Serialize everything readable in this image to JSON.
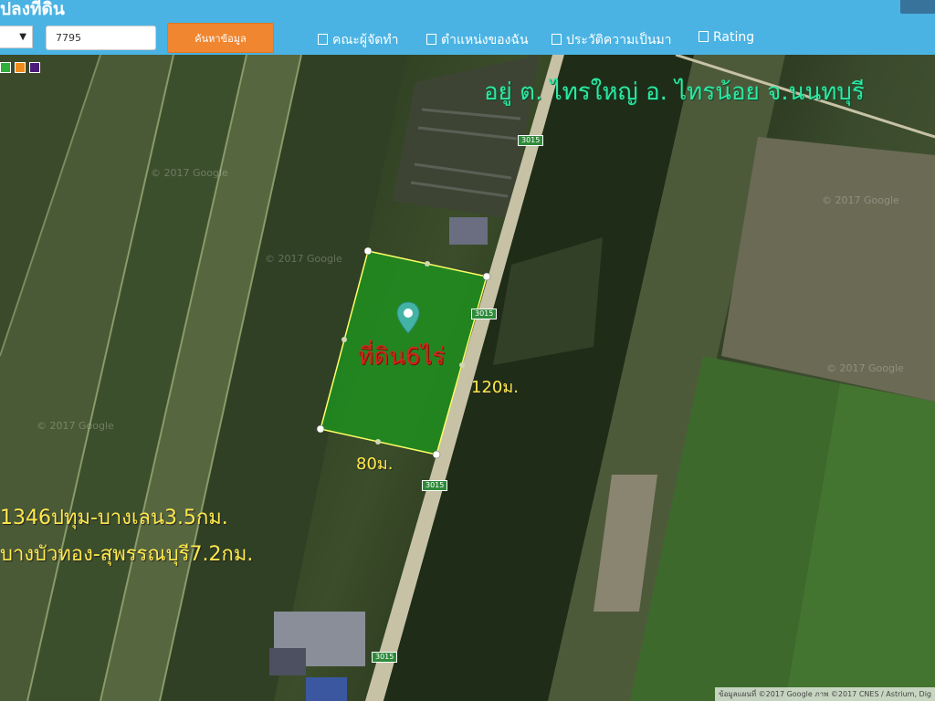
{
  "app": {
    "title": "ปลงที่ดิน"
  },
  "search": {
    "province_value": "",
    "parcel_value": "7795",
    "button_label": "ค้นหาข้อมูล"
  },
  "nav": [
    {
      "label": "คณะผู้จัดทำ"
    },
    {
      "label": "ตำแหน่งของฉัน"
    },
    {
      "label": "ประวัติความเป็นมา"
    },
    {
      "label": "Rating"
    }
  ],
  "colors": {
    "header": "#4ab3e3",
    "button": "#f0862f",
    "plot_fill": "#1f8f1f",
    "swatch_green": "#2fae3a",
    "swatch_orange": "#f08b1e",
    "swatch_purple": "#4b1a7a"
  },
  "map": {
    "location_text": "อยู่ ต. ไทรใหญ่ อ. ไทรน้อย จ.นนทบุรี",
    "plot_label": "ที่ดิน6ไร่",
    "width_label": "80ม.",
    "length_label": "120ม.",
    "route_line1": "1346ปทุม-บางเลน3.5กม.",
    "route_line2": "บางบัวทอง-สุพรรณบุรี7.2กม.",
    "road_numbers": [
      "3015",
      "3015",
      "3015",
      "3015"
    ],
    "attribution": "ข้อมูลแผนที่ ©2017 Google ภาพ ©2017 CNES / Astrium, Dig",
    "watermark": "© 2017 Google"
  }
}
